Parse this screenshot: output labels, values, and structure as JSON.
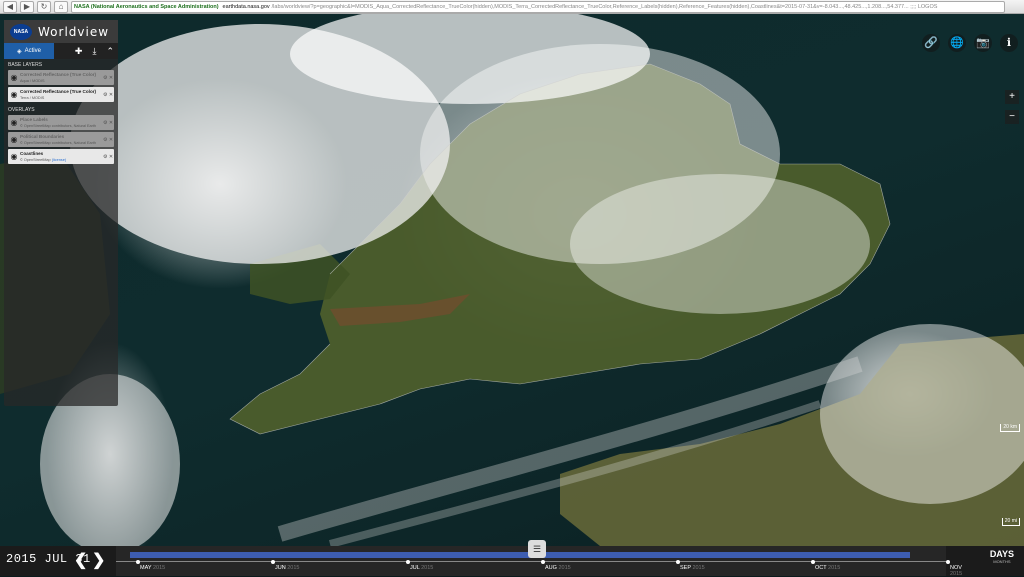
{
  "browser": {
    "ev_badge": "NASA (National Aeronautics and Space Administration)",
    "domain": "earthdata.nasa.gov",
    "path": "/labs/worldview/?p=geographic&l=MODIS_Aqua_CorrectedReflectance_TrueColor(hidden),MODIS_Terra_CorrectedReflectance_TrueColor,Reference_Labels(hidden),Reference_Features(hidden),Coastlines&t=2015-07-31&v=-8.043...,48.425...,1.208...,54.377... ;;;; LOGOS"
  },
  "app": {
    "org": "NASA",
    "title": "Worldview"
  },
  "panel": {
    "tab_active": "Active",
    "base_layers_heading": "BASE LAYERS",
    "overlays_heading": "OVERLAYS",
    "base_layers": [
      {
        "name": "Corrected Reflectance (True Color)",
        "source": "Aqua / MODIS",
        "visible": false
      },
      {
        "name": "Corrected Reflectance (True Color)",
        "source": "Terra / MODIS",
        "visible": true
      }
    ],
    "overlays": [
      {
        "name": "Place Labels",
        "source": "© OpenStreetMap contributors, Natural Earth",
        "visible": false
      },
      {
        "name": "Political Boundaries",
        "source": "© OpenStreetMap contributors, Natural Earth",
        "visible": false
      },
      {
        "name": "Coastlines",
        "source": "© OpenStreetMap",
        "license": "(license)",
        "visible": true
      }
    ]
  },
  "scale": {
    "km": "20 km",
    "mi": "20 mi"
  },
  "timeline": {
    "date": "2015 JUL 31",
    "zoom_level": "DAYS",
    "zoom_sub": "MONTHS",
    "months": [
      {
        "label": "MAY",
        "year": "2015"
      },
      {
        "label": "JUN",
        "year": "2015"
      },
      {
        "label": "JUL",
        "year": "2015"
      },
      {
        "label": "AUG",
        "year": "2015"
      },
      {
        "label": "SEP",
        "year": "2015"
      },
      {
        "label": "OCT",
        "year": "2015"
      },
      {
        "label": "NOV",
        "year": "2015"
      }
    ]
  },
  "icons": {
    "link": "link-icon",
    "globe": "globe-icon",
    "camera": "camera-icon",
    "info": "info-icon"
  }
}
